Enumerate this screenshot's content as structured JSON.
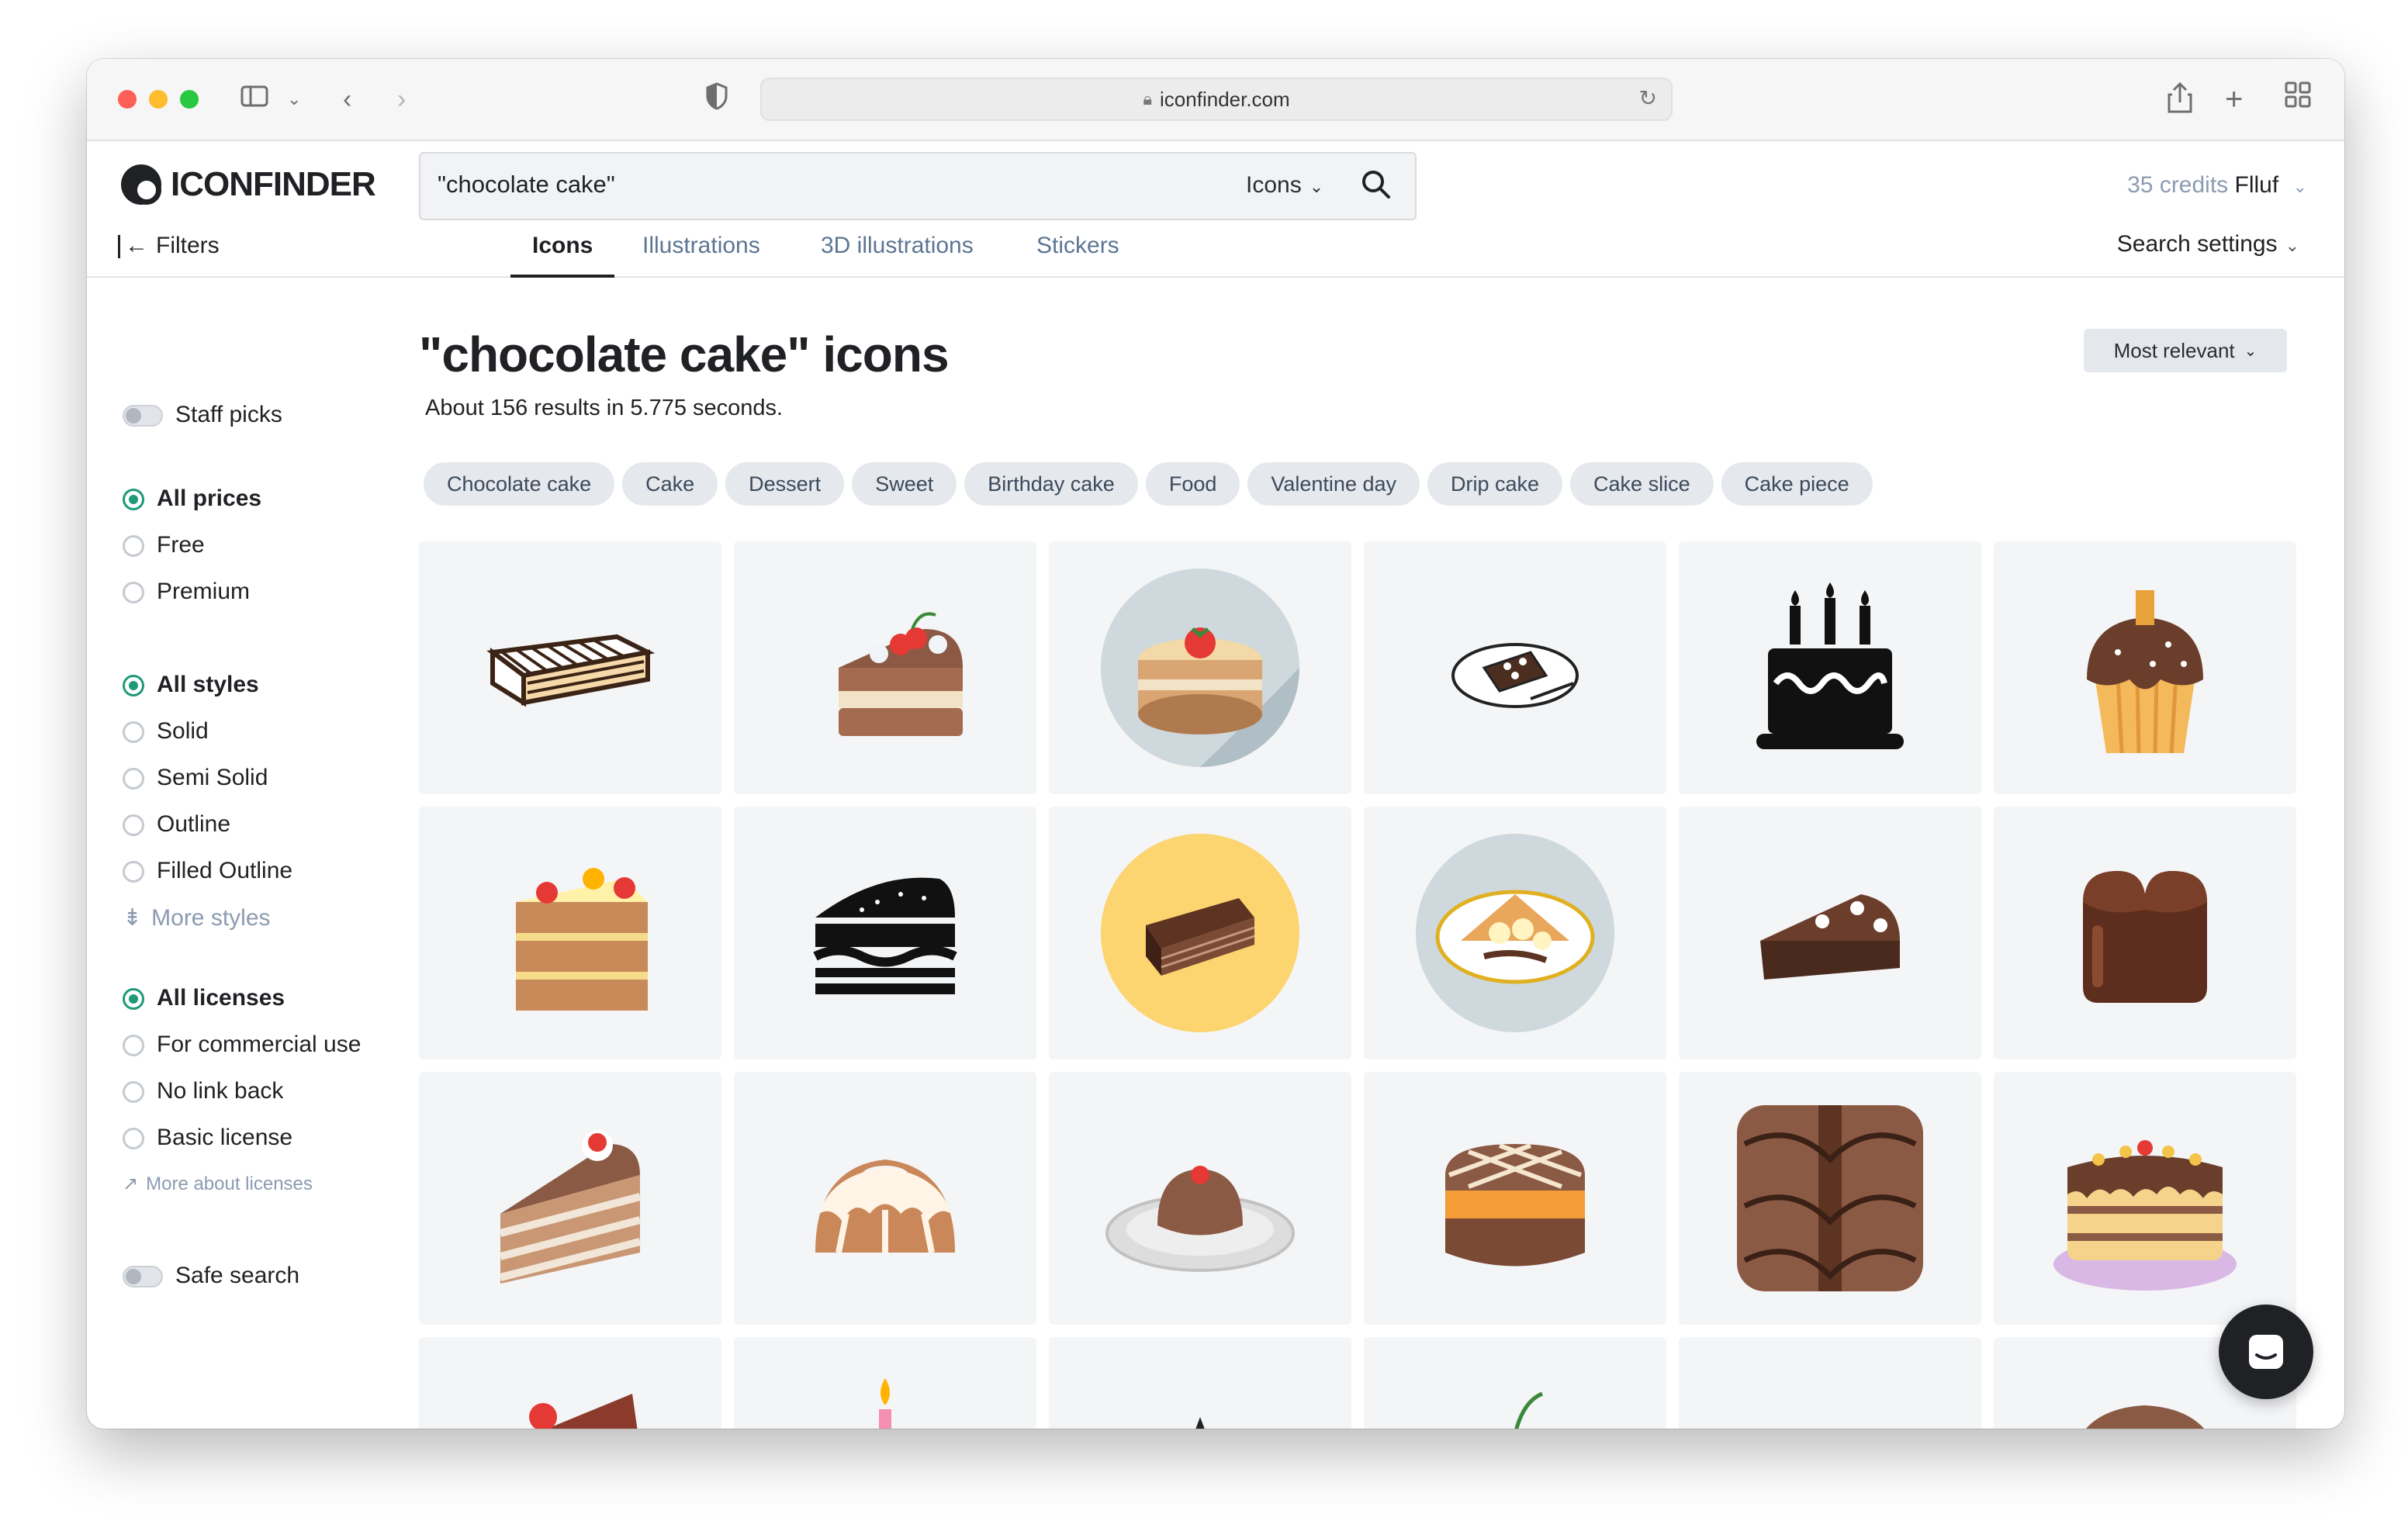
{
  "browser": {
    "url": "iconfinder.com"
  },
  "header": {
    "logo_text": "ICONFINDER",
    "search_value": "\"chocolate cake\"",
    "search_type": "Icons",
    "credits_count": "35 credits",
    "user_name": "Flluf"
  },
  "tabs": {
    "filters_label": "Filters",
    "items": [
      "Icons",
      "Illustrations",
      "3D illustrations",
      "Stickers"
    ],
    "active": "Icons",
    "search_settings": "Search settings"
  },
  "sidebar": {
    "staff_picks": "Staff picks",
    "prices": [
      "All prices",
      "Free",
      "Premium"
    ],
    "styles": [
      "All styles",
      "Solid",
      "Semi Solid",
      "Outline",
      "Filled Outline"
    ],
    "more_styles": "More styles",
    "licenses": [
      "All licenses",
      "For commercial use",
      "No link back",
      "Basic license"
    ],
    "more_about_licenses": "More about licenses",
    "safe_search": "Safe search"
  },
  "main": {
    "title": "\"chocolate cake\" icons",
    "results_text": "About 156 results in 5.775 seconds.",
    "sort_label": "Most relevant",
    "chips": [
      "Chocolate cake",
      "Cake",
      "Dessert",
      "Sweet",
      "Birthday cake",
      "Food",
      "Valentine day",
      "Drip cake",
      "Cake slice",
      "Cake piece"
    ]
  },
  "icons": [
    "wafer-cake-outline-icon",
    "cake-slice-cherry-icon",
    "round-cake-strawberry-icon",
    "plate-cake-sketch-icon",
    "birthday-cake-solid-icon",
    "cupcake-sprinkles-icon",
    "layer-cake-fruit-icon",
    "cake-slice-solid-icon",
    "chocolate-slice-yellow-circle-icon",
    "crepe-banana-plate-icon",
    "chocolate-slice-cream-icon",
    "heart-chocolate-cake-icon",
    "layer-cake-slice-cherry-icon",
    "bundt-cake-icon",
    "pudding-plate-icon",
    "waffle-cake-icon",
    "brownie-square-icon",
    "drip-cake-stand-icon",
    "cake-slice-cherry-partial-icon",
    "candle-cake-partial-icon",
    "cake-partial-icon",
    "cherry-cake-partial-icon",
    "round-cake-partial-icon",
    "dome-cake-partial-icon"
  ],
  "colors": {
    "accent_green": "#1e9a78",
    "chip_bg": "#e5e8ec",
    "cell_bg": "#f4f5f7",
    "link_blue_gray": "#5d7593"
  }
}
